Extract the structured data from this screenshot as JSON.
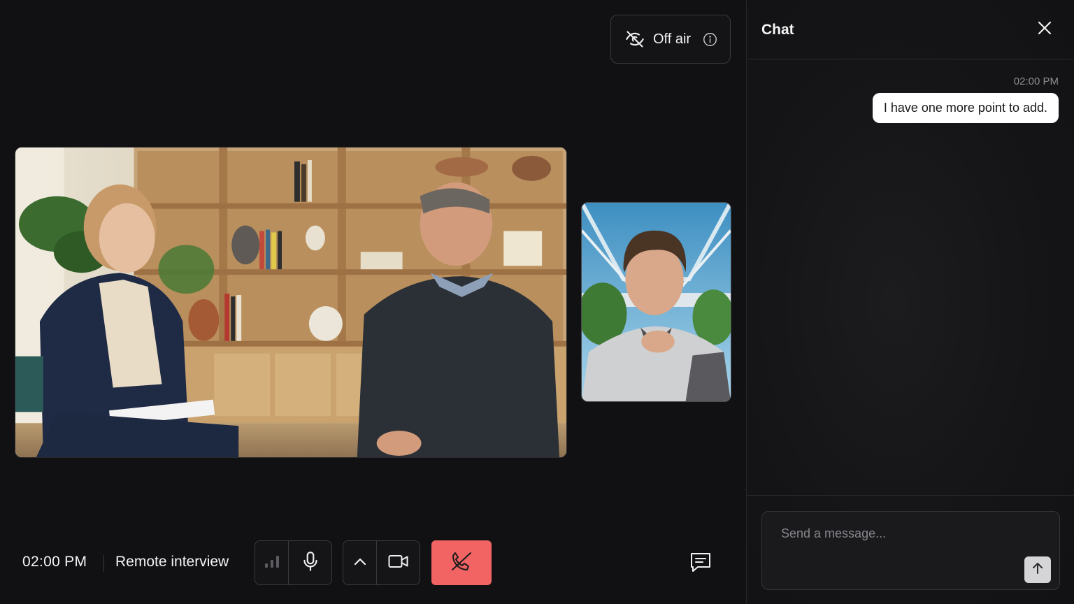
{
  "header": {
    "status_label": "Off air",
    "status_icon": "eye-off-icon",
    "info_icon": "info-icon"
  },
  "meeting": {
    "time": "02:00 PM",
    "title": "Remote interview"
  },
  "controls": {
    "signal_icon": "signal-bars-icon",
    "mic_icon": "microphone-icon",
    "chevron_icon": "chevron-up-icon",
    "camera_icon": "video-camera-icon",
    "end_call_icon": "phone-off-icon",
    "chat_icon": "chat-bubble-icon",
    "end_call_color": "#f26464"
  },
  "chat": {
    "title": "Chat",
    "close_icon": "close-icon",
    "messages": [
      {
        "time": "02:00 PM",
        "text": "I have one more point to add."
      }
    ],
    "composer_placeholder": "Send a message...",
    "send_icon": "arrow-up-icon"
  }
}
